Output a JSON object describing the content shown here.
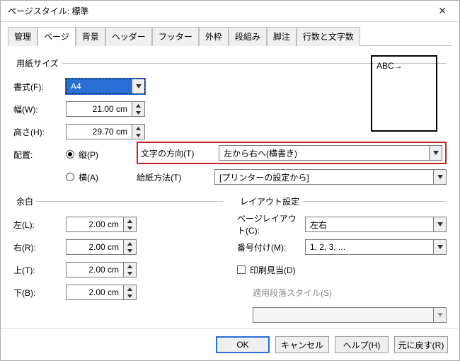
{
  "title": "ページスタイル: 標準",
  "tabs": [
    "管理",
    "ページ",
    "背景",
    "ヘッダー",
    "フッター",
    "外枠",
    "段組み",
    "脚注",
    "行数と文字数"
  ],
  "active_tab": "ページ",
  "paper": {
    "legend": "用紙サイズ",
    "format_label": "書式(F):",
    "format_value": "A4",
    "width_label": "幅(W):",
    "width_value": "21.00 cm",
    "height_label": "高さ(H):",
    "height_value": "29.70 cm",
    "orient_label": "配置:",
    "orient_portrait": "縦(P)",
    "orient_landscape": "横(A)"
  },
  "highlight": {
    "textdir_label": "文字の方向(T)",
    "textdir_value": "左から右へ(横書き)"
  },
  "papersrc": {
    "label": "給紙方法(T)",
    "value": "[プリンターの設定から]"
  },
  "preview_text": "ABC→",
  "margins": {
    "legend": "余白",
    "left_label": "左(L):",
    "left_value": "2.00 cm",
    "right_label": "右(R):",
    "right_value": "2.00 cm",
    "top_label": "上(T):",
    "top_value": "2.00 cm",
    "bottom_label": "下(B):",
    "bottom_value": "2.00 cm"
  },
  "layout": {
    "legend": "レイアウト設定",
    "pagelayout_label": "ページレイアウト(C):",
    "pagelayout_value": "左右",
    "numbering_label": "番号付け(M):",
    "numbering_value": "1, 2, 3, ...",
    "register_label": "印刷見当(D)",
    "refstyle_label": "適用段落スタイル(S)",
    "refstyle_value": ""
  },
  "buttons": {
    "ok": "OK",
    "cancel": "キャンセル",
    "help": "ヘルプ(H)",
    "reset": "元に戻す(R)"
  }
}
